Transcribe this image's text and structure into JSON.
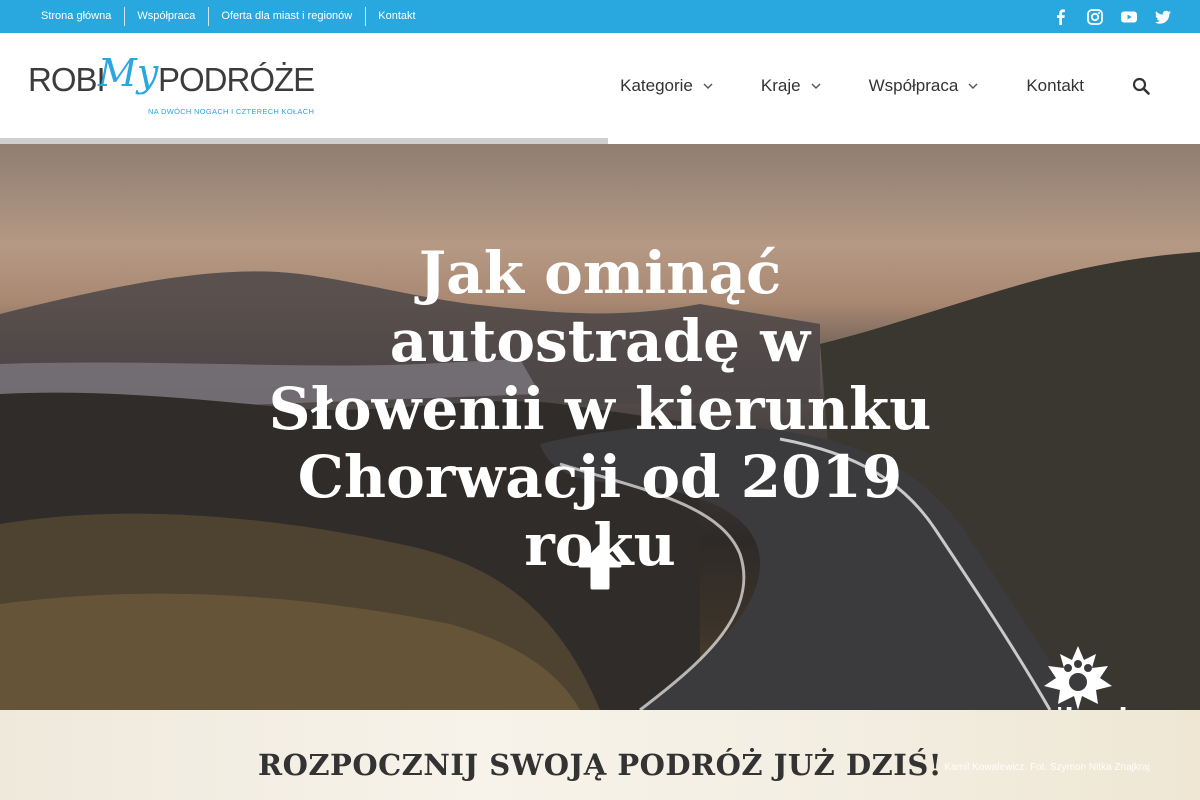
{
  "topbar": {
    "links": [
      "Strona główna",
      "Współpraca",
      "Oferta dla miast i regionów",
      "Kontakt"
    ],
    "social_icons": [
      "facebook-icon",
      "instagram-icon",
      "youtube-icon",
      "twitter-icon"
    ],
    "color": "#29a8df"
  },
  "logo": {
    "part1": "ROBI",
    "script": "My",
    "part2": "PODRÓŻE",
    "tagline": "NA DWÓCH NOGACH I CZTERECH KOŁACH"
  },
  "nav": {
    "items": [
      {
        "label": "Kategorie",
        "dropdown": true
      },
      {
        "label": "Kraje",
        "dropdown": true
      },
      {
        "label": "Współpraca",
        "dropdown": true
      },
      {
        "label": "Kontakt",
        "dropdown": false
      }
    ],
    "search_icon": "search-icon"
  },
  "reading_progress": 0.507,
  "hero": {
    "title": "Jak ominąć autostradę w Słowenii w kierunku Chorwacji od 2019 roku",
    "watermark": {
      "prefix": "znaj",
      "suffix": "kraj"
    }
  },
  "band": {
    "title": "ROZPOCZNIJ SWOJĄ PODRÓŻ JUŻ DZIŚ!",
    "credit": "Kamil Kowalewicz. Fot. Szymon Nitka Znajkraj"
  }
}
